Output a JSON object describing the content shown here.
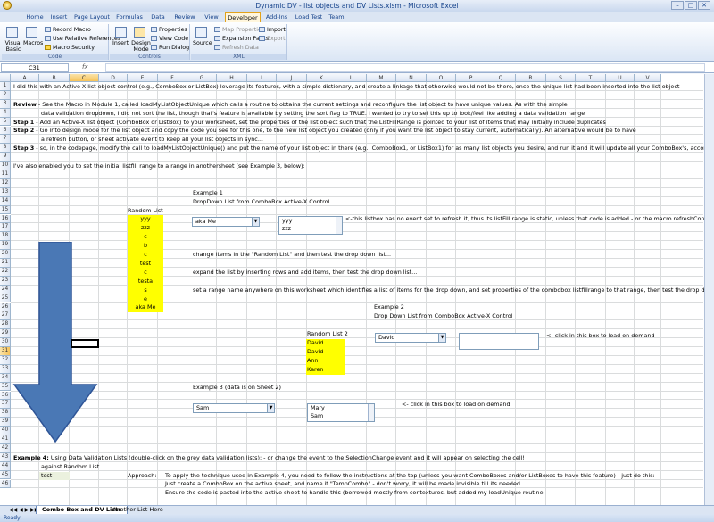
{
  "window": {
    "title": "Dynamic DV - list objects and DV Lists.xlsm - Microsoft Excel",
    "controls": [
      "–",
      "□",
      "✕"
    ]
  },
  "ribbon_tabs": [
    "Home",
    "Insert",
    "Page Layout",
    "Formulas",
    "Data",
    "Review",
    "View",
    "Developer",
    "Add-Ins",
    "Load Test",
    "Team"
  ],
  "active_tab": "Developer",
  "ribbon": {
    "code": {
      "visual_basic": "Visual Basic",
      "macros": "Macros",
      "record": "Record Macro",
      "relative": "Use Relative References",
      "security": "Macro Security",
      "label": "Code"
    },
    "controls": {
      "insert": "Insert",
      "design_mode": "Design Mode",
      "properties": "Properties",
      "view_code": "View Code",
      "run_dialog": "Run Dialog",
      "label": "Controls"
    },
    "xml": {
      "source": "Source",
      "map_properties": "Map Properties",
      "expansion_packs": "Expansion Packs",
      "refresh_data": "Refresh Data",
      "import": "Import",
      "export": "Export",
      "label": "XML"
    }
  },
  "formula_bar": {
    "name_box": "C31",
    "fx": "fx",
    "value": ""
  },
  "columns": [
    "A",
    "B",
    "C",
    "D",
    "E",
    "F",
    "G",
    "H",
    "I",
    "J",
    "K",
    "L",
    "M",
    "N",
    "O",
    "P",
    "Q",
    "R",
    "S",
    "T",
    "U",
    "V"
  ],
  "rows": [
    "1",
    "2",
    "3",
    "4",
    "5",
    "6",
    "7",
    "8",
    "9",
    "10",
    "11",
    "12",
    "13",
    "14",
    "15",
    "16",
    "17",
    "18",
    "19",
    "20",
    "21",
    "22",
    "23",
    "24",
    "25",
    "26",
    "27",
    "28",
    "29",
    "30",
    "31",
    "32",
    "33",
    "34",
    "35",
    "36",
    "37",
    "38",
    "39",
    "40",
    "41",
    "42",
    "43",
    "44",
    "45",
    "46"
  ],
  "selected": {
    "column": "C",
    "row": "31"
  },
  "cells": {
    "r1": "I did this with an Active-X list object control (e.g., ComboBox or ListBox) leverage its features, with a simple dictionary, and create a linkage that otherwise would not be there, once the unique list had been inserted into the list object",
    "r3_bold": "Review",
    "r3": " - See the Macro in Module 1, called loadMyListObjectUnique which calls a routine to obtains the current settings and reconfigure the list object to have unique values.  As with the simple",
    "r4": "data validation dropdown, I did not sort the list, though that's feature is available by setting the sort flag to TRUE.  I wanted to try to set this up to look/feel like adding a data validation range",
    "r5_bold": "Step 1",
    "r5": " - Add an Active-X list object (ComboBox or ListBox) to your worksheet, set the properties of the list object such that the ListFillRange is pointed to your list of items that may initially include duplicates",
    "r6_bold": "Step 2",
    "r6": " - Go into design mode for the list object and copy the code you see for this one, to the new list object you created (only if you want the list object to stay current, automatically).  An alternative would be to have",
    "r7": "a refresh button, or sheet activate event to keep all your list objects in sync...",
    "r8_bold": "Step 3",
    "r8": " - so, in the codepage, modify the call to loadMyListObjectUnique() and put the name of your list object in there (e.g., ComboBox1, or ListBox1) for as many list objects you desire, and run it and it will update all your ComboBox's, accordingly",
    "r10": "I've also enabled you to set the initial listfill range to a range in anothersheet (see Example 3, below):",
    "ex1_title": "Example 1",
    "ex1_sub": "DropDown List from ComboBox Active-X Control",
    "random_list_header": "Random List",
    "random_list": [
      "yyy",
      "zzz",
      "c",
      "b",
      "c",
      "test",
      "c",
      "testa",
      "s",
      "e",
      "aka Me"
    ],
    "ex1_combo": "aka Me",
    "ex1_listbox": [
      "yyy",
      "zzz"
    ],
    "ex1_note": "<-this listbox has no event set to refresh it, thus its listFill range is static, unless that code is added - or the macro refreshControlsOnSheet",
    "r20": "change items in the \"Random List\" and then test the drop down list...",
    "r22": "expand the list by inserting rows and add items, then test the drop down list...",
    "r24": "set a range name anywhere on this worksheet which identifies a list of items for the drop down, and set properties of the combobox listfillrange to that range, then test the drop down list...",
    "ex2_title": "Example 2",
    "ex2_sub": "Drop Down List from ComboBox Active-X Control",
    "random_list2_header": "Random List 2",
    "random_list2": [
      "David",
      "David",
      "Ann",
      "Karen"
    ],
    "ex2_combo": "David",
    "ex2_note": "<- click in this box to load on demand",
    "ex3_title": "Example 3 (data is on Sheet 2)",
    "ex3_combo": "Sam",
    "ex3_listbox": [
      "Mary",
      "Sam"
    ],
    "ex3_note": "<- click in this box to load on demand",
    "r43_bold": "Example 4:",
    "r43": " Using Data Validation Lists (double-click on the grey data validation lists): - or change the event to the SelectionChange event and it will appear on selecting the cell!",
    "r44": "against Random List",
    "r45_val": "test",
    "r45_approach": "Approach:",
    "r45": "To apply the technique used in Example 4, you need to follow the instructions at the top (unless you want ComboBoxes and/or ListBoxes to have this feature) - just do this:",
    "r46": "Just create a ComboBox on the active sheet, and name it \"TempCombo\" - don't worry, it will be made invisible till its needed",
    "r47": "Ensure the code is pasted into the active sheet to handle this (borrowed mostly from contextures, but added my loadUnique routine"
  },
  "sheet_tabs": [
    "Combo Box and DV Lists",
    "Another List Here"
  ],
  "status": "Ready",
  "colors": {
    "highlight": "#ffff00",
    "arrow": "#4a78b5",
    "arrow_border": "#2f5597"
  }
}
